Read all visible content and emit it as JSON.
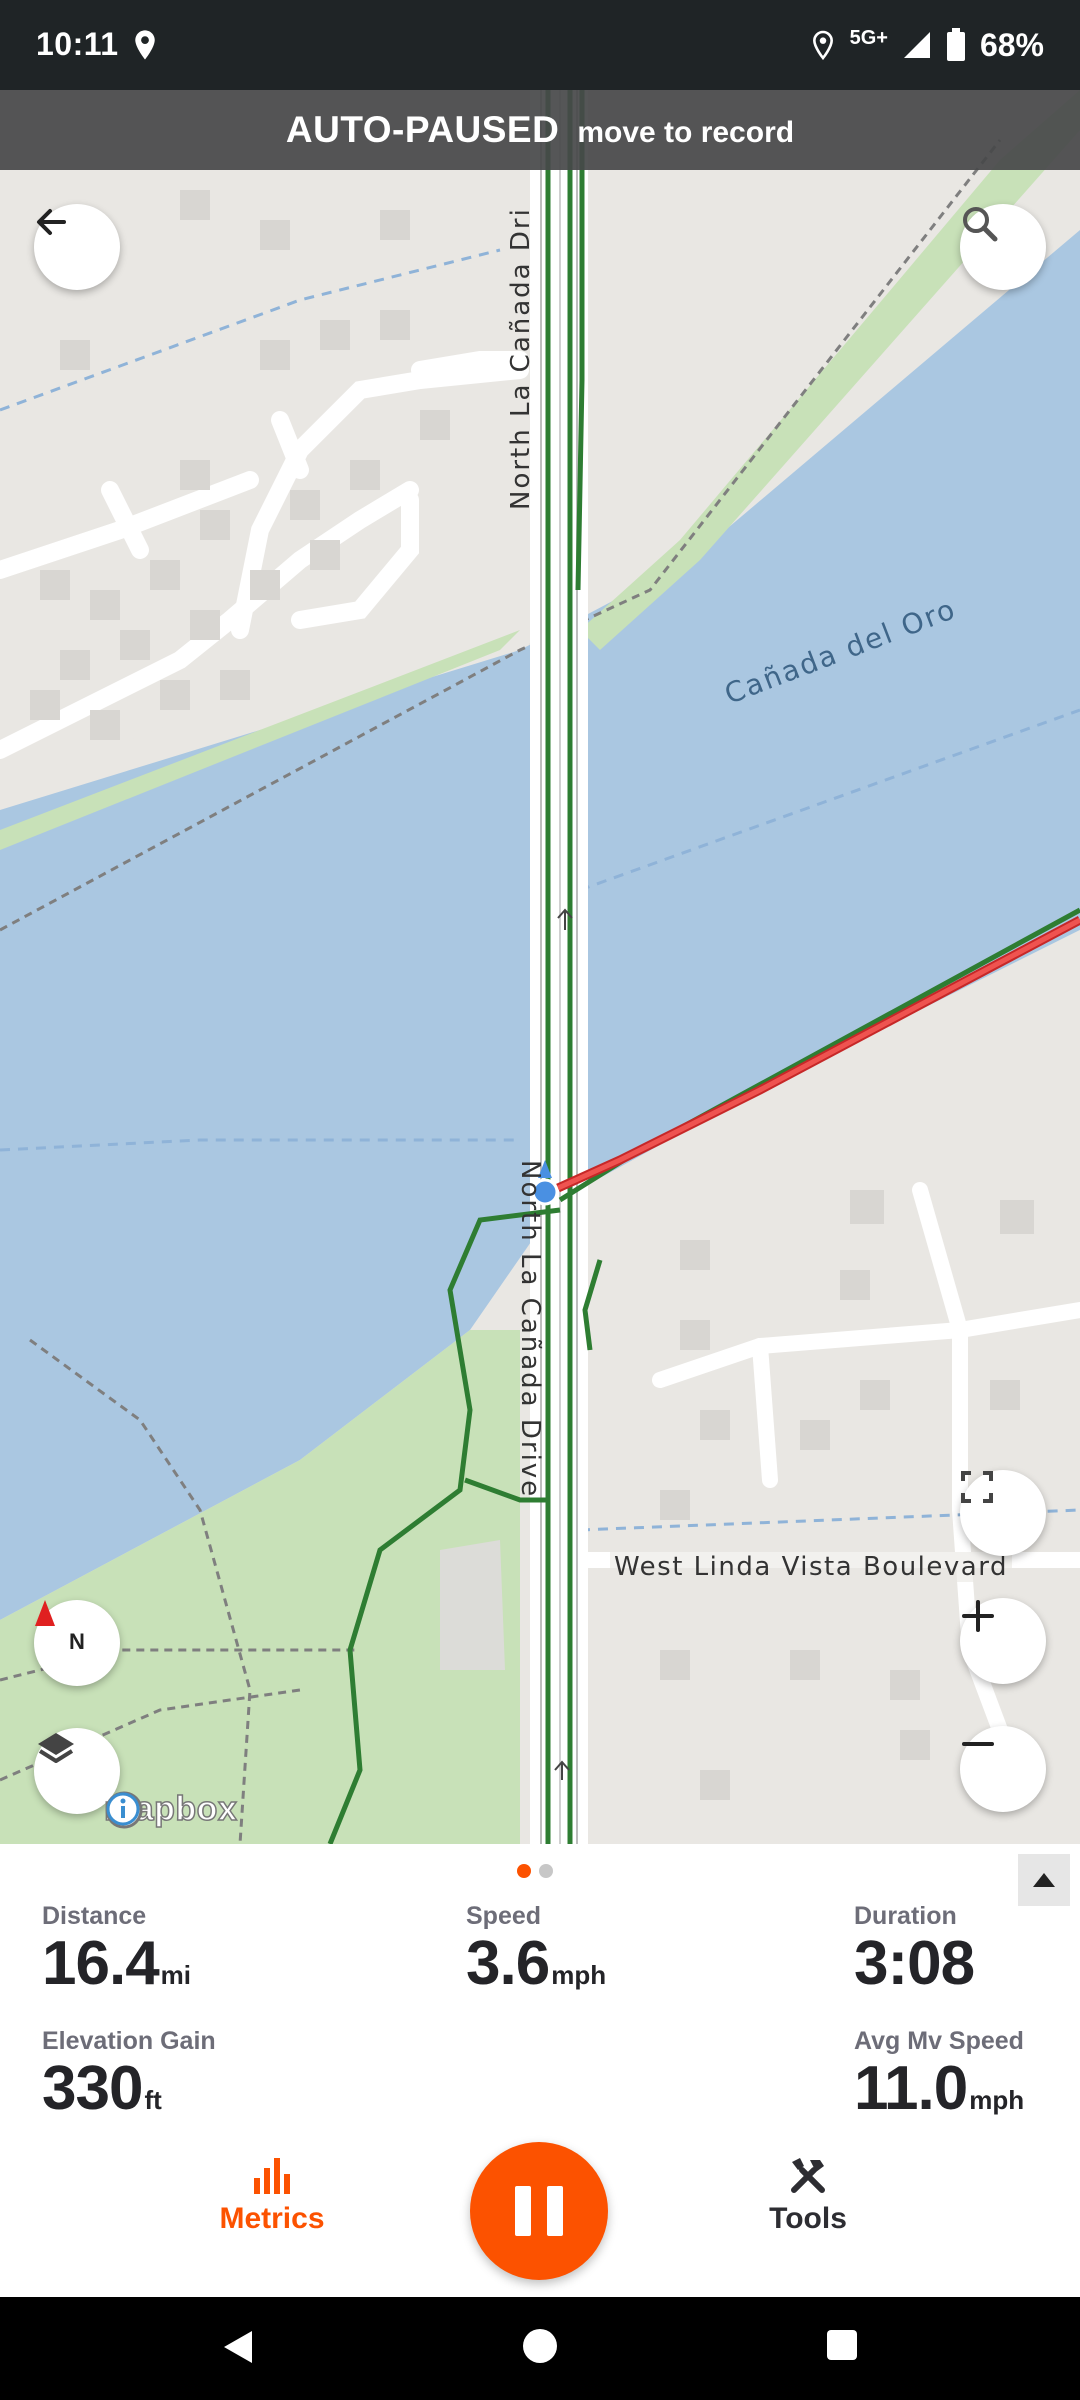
{
  "status_bar": {
    "time": "10:11",
    "network": "5G+",
    "battery": "68%",
    "icons": [
      "location-pin-icon",
      "location-icon",
      "signal-icon",
      "battery-icon"
    ]
  },
  "banner": {
    "title": "AUTO-PAUSED",
    "subtitle": "move to record"
  },
  "map": {
    "labels": {
      "road_top": "North La Cañada Dri",
      "road_mid": "North La Cañada Drive",
      "water": "Cañada del Oro",
      "blvd": "West Linda Vista Boulevard"
    },
    "compass_label": "N",
    "attribution": "mapbox",
    "colors": {
      "land": "#e9e7e3",
      "water": "#aac7e1",
      "park": "#c8e1b8",
      "trail": "#2e7d32",
      "route": "#e53935"
    }
  },
  "pager": {
    "pages": 2,
    "active": 1
  },
  "metrics": {
    "distance": {
      "label": "Distance",
      "value": "16.4",
      "unit": "mi"
    },
    "speed": {
      "label": "Speed",
      "value": "3.6",
      "unit": "mph"
    },
    "duration": {
      "label": "Duration",
      "value": "3:08",
      "unit": ""
    },
    "elevation": {
      "label": "Elevation Gain",
      "value": "330",
      "unit": "ft"
    },
    "avg_speed": {
      "label": "Avg Mv Speed",
      "value": "11.0",
      "unit": "mph"
    }
  },
  "bottom_nav": {
    "metrics_label": "Metrics",
    "tools_label": "Tools",
    "accent": "#fc5200"
  }
}
